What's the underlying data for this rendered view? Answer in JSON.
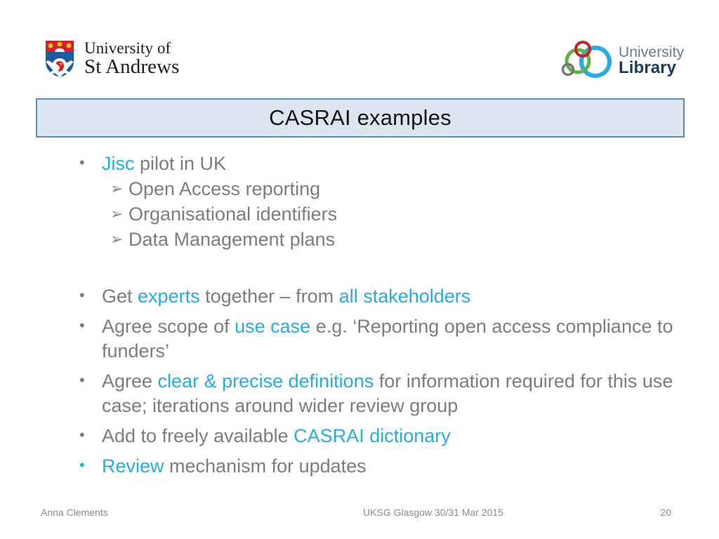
{
  "header": {
    "standrews_logo": {
      "line1": "University of",
      "line2": "St Andrews",
      "crest_icon": "st-andrews-crest-icon"
    },
    "library_logo": {
      "line1": "University",
      "line2": "Library",
      "mark_icon": "overlapping-rings-icon"
    }
  },
  "title": {
    "text": "CASRAI examples"
  },
  "colors": {
    "accent": "#29abe2",
    "body_text": "#7d7d7d",
    "title_text": "#141414",
    "banner_fill": "#dce5f0",
    "banner_border": "#5b8cc4",
    "footer_text": "#8c8c8c",
    "library_blue": "#29abe2",
    "library_green": "#5fb14a",
    "library_red": "#c8202a",
    "library_grey": "#76766e",
    "crest_blue": "#1b5a9e",
    "crest_red": "#d1222b"
  },
  "content": {
    "block1": {
      "bullet": {
        "marker": "•",
        "pre": "",
        "highlight": "Jisc",
        "post": " pilot in UK"
      },
      "subbullets": [
        {
          "arrow": "➢",
          "text": "Open Access reporting"
        },
        {
          "arrow": "➢",
          "text": "Organisational identifiers"
        },
        {
          "arrow": "➢",
          "text": "Data Management plans"
        }
      ]
    },
    "block2": [
      {
        "marker": "•",
        "marker_accent": false,
        "seg1": "Get ",
        "hl1": "experts",
        "seg2": " together – from ",
        "hl2": "all stakeholders",
        "seg3": ""
      },
      {
        "marker": "•",
        "marker_accent": false,
        "seg1": "Agree scope of ",
        "hl1": "use case",
        "seg2": " e.g. ‘Reporting open access compliance to funders’",
        "hl2": "",
        "seg3": ""
      },
      {
        "marker": "•",
        "marker_accent": false,
        "seg1": "Agree ",
        "hl1": "clear & precise definitions",
        "seg2": " for information required for this use case; iterations around wider review group",
        "hl2": "",
        "seg3": ""
      },
      {
        "marker": "•",
        "marker_accent": false,
        "seg1": "Add to freely available ",
        "hl1": "CASRAI dictionary",
        "seg2": "",
        "hl2": "",
        "seg3": ""
      },
      {
        "marker": "•",
        "marker_accent": true,
        "seg1": "",
        "hl1": "Review",
        "seg2": " mechanism for updates",
        "hl2": "",
        "seg3": ""
      }
    ]
  },
  "footer": {
    "author": "Anna Clements",
    "event": "UKSG Glasgow 30/31 Mar 2015",
    "page_number": "20"
  }
}
